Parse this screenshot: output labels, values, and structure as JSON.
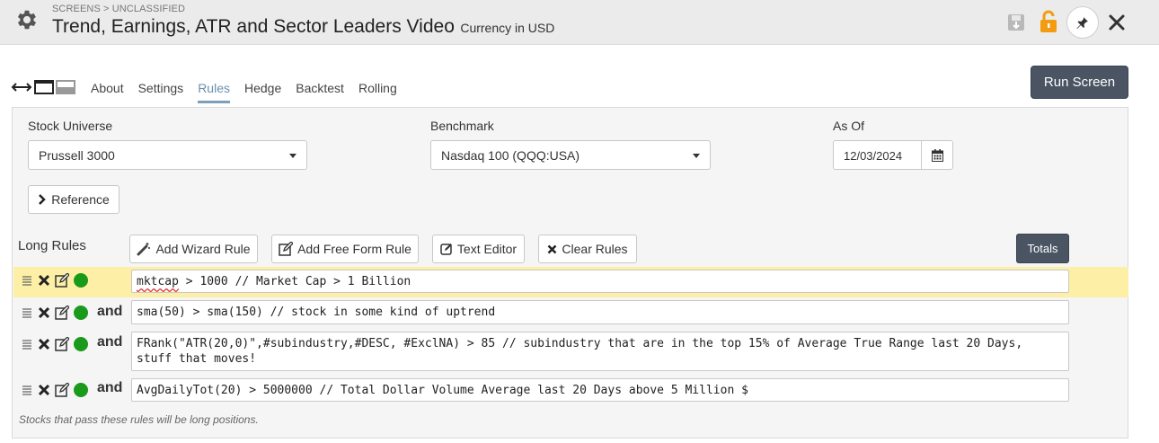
{
  "header": {
    "breadcrumb": "SCREENS > UNCLASSIFIED",
    "title": "Trend, Earnings, ATR and Sector Leaders Video",
    "currency": "Currency in USD"
  },
  "tabs": [
    {
      "label": "About"
    },
    {
      "label": "Settings"
    },
    {
      "label": "Rules",
      "active": true
    },
    {
      "label": "Hedge"
    },
    {
      "label": "Backtest"
    },
    {
      "label": "Rolling"
    }
  ],
  "run_button": "Run Screen",
  "universe": {
    "label": "Stock Universe",
    "value": "Prussell 3000"
  },
  "benchmark": {
    "label": "Benchmark",
    "value": "Nasdaq 100 (QQQ:USA)"
  },
  "as_of": {
    "label": "As Of",
    "value": "12/03/2024"
  },
  "reference_button": "Reference",
  "long_rules": {
    "label": "Long Rules",
    "buttons": {
      "add_wizard": "Add Wizard Rule",
      "add_free_form": "Add Free Form Rule",
      "text_editor": "Text Editor",
      "clear_rules": "Clear Rules",
      "totals": "Totals"
    },
    "rules": [
      {
        "connector": "",
        "text_prefix": "mktcap",
        "text_rest": " > 1000 // Market Cap > 1 Billion"
      },
      {
        "connector": "and",
        "text": "sma(50) > sma(150) // stock in some kind of uptrend"
      },
      {
        "connector": "and",
        "text": "FRank(\"ATR(20,0)\",#subindustry,#DESC, #ExclNA) > 85 // subindustry that are in the top 15% of Average True Range last 20 Days,\nstuff that moves!"
      },
      {
        "connector": "and",
        "text": "AvgDailyTot(20) > 5000000 // Total Dollar Volume Average last 20 Days above 5 Million $"
      }
    ],
    "note": "Stocks that pass these rules will be long positions."
  },
  "colors": {
    "accent": "#6c8faf",
    "dark_button": "#4a5463",
    "lock": "#f39c12",
    "status_green": "#1a9a1a",
    "highlight_row": "#fdf0a6"
  },
  "icons": [
    "gear-icon",
    "save-icon",
    "lock-icon",
    "pin-icon",
    "close-icon",
    "calendar-icon",
    "chevron-right-icon",
    "wand-icon",
    "edit-icon",
    "x-icon",
    "drag-handle-icon",
    "status-dot-icon"
  ]
}
